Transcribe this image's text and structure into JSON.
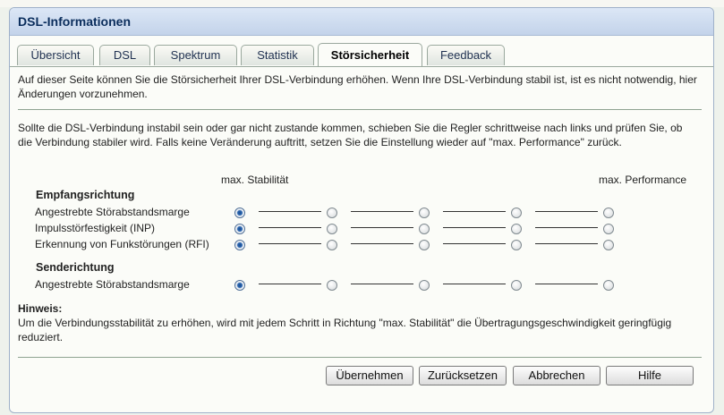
{
  "window": {
    "title": "DSL-Informationen"
  },
  "tabs": [
    {
      "label": "Übersicht"
    },
    {
      "label": "DSL"
    },
    {
      "label": "Spektrum"
    },
    {
      "label": "Statistik"
    },
    {
      "label": "Störsicherheit",
      "active": true
    },
    {
      "label": "Feedback"
    }
  ],
  "intro": "Auf dieser Seite können Sie die Störsicherheit Ihrer DSL-Verbindung erhöhen. Wenn Ihre DSL-Verbindung stabil ist, ist es nicht notwendig, hier Änderungen vorzunehmen.",
  "instructions": "Sollte die DSL-Verbindung instabil sein oder gar nicht zustande kommen, schieben Sie die Regler schrittweise nach links und prüfen Sie, ob die Verbindung stabiler wird. Falls keine Veränderung auftritt, setzen Sie die Einstellung wieder auf \"max. Performance\" zurück.",
  "scale": {
    "left_label": "max. Stabilität",
    "right_label": "max. Performance"
  },
  "sections": {
    "empfang": {
      "title": "Empfangsrichtung",
      "rows": [
        {
          "label": "Angestrebte Störabstandsmarge",
          "selected": 0
        },
        {
          "label": "Impulsstörfestigkeit (INP)",
          "selected": 0
        },
        {
          "label": "Erkennung von Funkstörungen (RFI)",
          "selected": 0
        }
      ]
    },
    "sende": {
      "title": "Senderichtung",
      "rows": [
        {
          "label": "Angestrebte Störabstandsmarge",
          "selected": 0
        }
      ]
    }
  },
  "hint": {
    "title": "Hinweis:",
    "text": "Um die Verbindungsstabilität zu erhöhen, wird mit jedem Schritt in Richtung \"max. Stabilität\" die Übertragungsgeschwindigkeit geringfügig reduziert."
  },
  "buttons": {
    "apply": "Übernehmen",
    "reset": "Zurücksetzen",
    "cancel": "Abbrechen",
    "help": "Hilfe"
  },
  "colors": {
    "title_text": "#0a2d5c",
    "title_bg": "#c3d3ea",
    "separator": "#8ea391",
    "radio_selected": "#2b66b0"
  }
}
